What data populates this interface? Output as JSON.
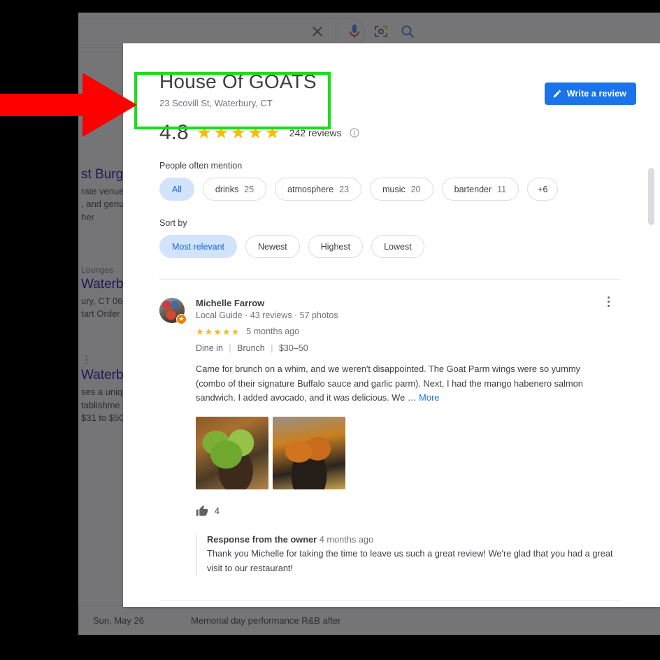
{
  "background": {
    "searchbar": {
      "icons": [
        "close-icon",
        "microphone-icon",
        "lens-icon",
        "search-icon"
      ]
    },
    "results": [
      {
        "title_fragment": "st Burg",
        "lines": [
          "rate venue",
          ", and genu",
          "her"
        ]
      },
      {
        "category_fragment": "Lounges",
        "title_fragment": "Waterb",
        "lines": [
          "ury, CT 06",
          "tart Order"
        ]
      },
      {
        "title_fragment": "Waterbu",
        "lines": [
          "ses a uniqu",
          "tablishme",
          " $31 to $50"
        ]
      }
    ],
    "events": {
      "date": "Sun, May 26",
      "description": "Memorial day performance R&B after"
    }
  },
  "modal": {
    "place": {
      "name": "House Of GOATS",
      "address": "23 Scovill St, Waterbury, CT"
    },
    "write_review_label": "Write a review",
    "rating": {
      "score": "4.8",
      "stars": "★★★★★",
      "review_count": "242 reviews",
      "info_icon": "info-icon"
    },
    "mentions": {
      "label": "People often mention",
      "chips": [
        {
          "label": "All",
          "count": "",
          "selected": true
        },
        {
          "label": "drinks",
          "count": "25",
          "selected": false
        },
        {
          "label": "atmosphere",
          "count": "23",
          "selected": false
        },
        {
          "label": "music",
          "count": "20",
          "selected": false
        },
        {
          "label": "bartender",
          "count": "11",
          "selected": false
        },
        {
          "label": "+6",
          "count": "",
          "selected": false
        }
      ]
    },
    "sort": {
      "label": "Sort by",
      "chips": [
        {
          "label": "Most relevant",
          "selected": true
        },
        {
          "label": "Newest",
          "selected": false
        },
        {
          "label": "Highest",
          "selected": false
        },
        {
          "label": "Lowest",
          "selected": false
        }
      ]
    },
    "review": {
      "author": "Michelle Farrow",
      "meta": "Local Guide · 43 reviews · 57 photos",
      "stars": "★★★★★",
      "age": "5 months ago",
      "attr_1": "Dine in",
      "attr_2": "Brunch",
      "attr_3": "$30–50",
      "text": "Came for brunch on a whim, and we weren't disappointed.  The Goat Parm wings were so yummy (combo of their signature Buffalo sauce and garlic parm). Next, I had the mango habenero salmon sandwich.  I added avocado, and it was delicious.  We …",
      "more_label": "More",
      "like_count": "4",
      "photo_alt_1": "grilled-dish-with-avocado-photo",
      "photo_alt_2": "fried-wings-photo",
      "owner_response": {
        "label": "Response from the owner",
        "age": "4 months ago",
        "text": "Thank you Michelle for taking the time to leave us such a great review! We're glad that you had a great visit to our restaurant!"
      }
    }
  },
  "annotations": {
    "highlight_color": "#19e019",
    "arrow_color": "#ff0000"
  }
}
